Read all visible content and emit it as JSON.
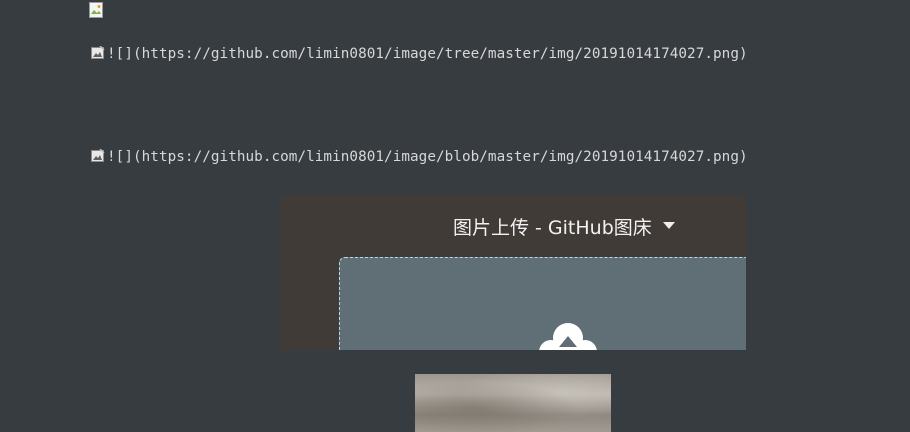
{
  "markdown_lines": [
    {
      "icon": "broken-image-icon",
      "text": "![](https://github.com/limin0801/image/tree/master/img/20191014174027.png)"
    },
    {
      "icon": "broken-image-icon",
      "text": "![](https://github.com/limin0801/image/blob/master/img/20191014174027.png)"
    }
  ],
  "embedded_screenshot": {
    "title": "图片上传 - GitHub图床",
    "caret_icon": "caret-down-icon",
    "upload_icon": "cloud-upload-icon",
    "colors": {
      "background": "#403b36",
      "dropzone": "#606f76",
      "dropzone_border": "#b9d6ec"
    }
  },
  "colors": {
    "page_background": "#373c41",
    "text": "#d7d7d7"
  }
}
